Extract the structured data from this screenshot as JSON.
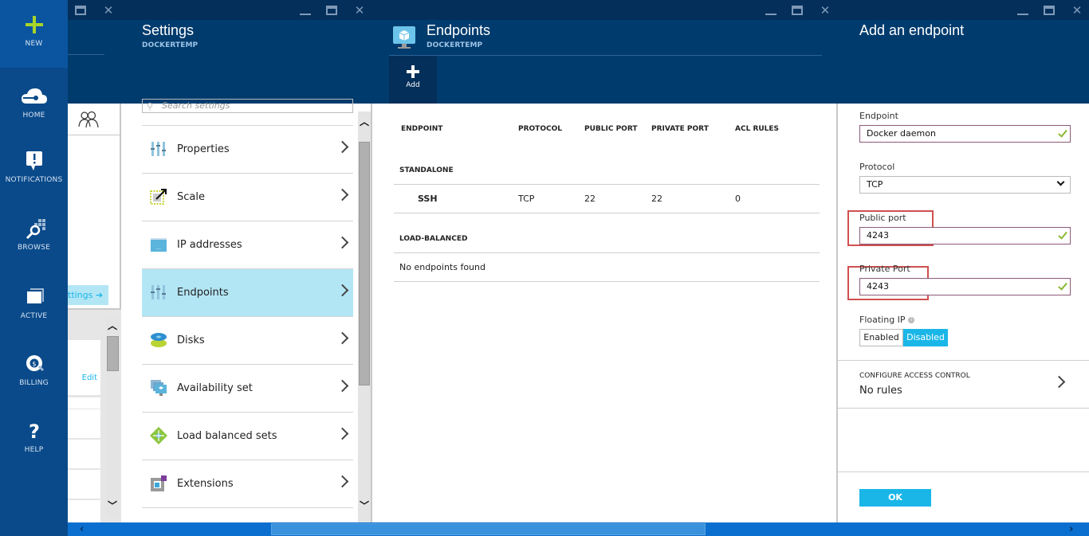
{
  "nav": {
    "items": [
      {
        "label": "NEW",
        "icon": "plus-icon"
      },
      {
        "label": "HOME",
        "icon": "cloud-icon"
      },
      {
        "label": "NOTIFICATIONS",
        "icon": "notification-icon"
      },
      {
        "label": "BROWSE",
        "icon": "browse-icon"
      },
      {
        "label": "ACTIVE",
        "icon": "active-windows-icon"
      },
      {
        "label": "BILLING",
        "icon": "billing-icon"
      },
      {
        "label": "HELP",
        "icon": "help-icon"
      }
    ]
  },
  "blade1": {
    "settings_link": "ttings",
    "edit_label": "Edit"
  },
  "settings": {
    "title": "Settings",
    "subtitle": "DOCKERTEMP",
    "search_placeholder": "Search settings",
    "items": [
      {
        "label": "Properties",
        "icon": "properties-icon"
      },
      {
        "label": "Scale",
        "icon": "scale-icon"
      },
      {
        "label": "IP addresses",
        "icon": "ip-addresses-icon"
      },
      {
        "label": "Endpoints",
        "icon": "endpoints-icon",
        "selected": true
      },
      {
        "label": "Disks",
        "icon": "disks-icon"
      },
      {
        "label": "Availability set",
        "icon": "availability-set-icon"
      },
      {
        "label": "Load balanced sets",
        "icon": "load-balanced-icon"
      },
      {
        "label": "Extensions",
        "icon": "extensions-icon"
      }
    ]
  },
  "endpoints": {
    "title": "Endpoints",
    "subtitle": "DOCKERTEMP",
    "add_label": "Add",
    "columns": [
      "ENDPOINT",
      "PROTOCOL",
      "PUBLIC PORT",
      "PRIVATE PORT",
      "ACL RULES"
    ],
    "standalone_label": "STANDALONE",
    "rows": [
      {
        "endpoint": "SSH",
        "protocol": "TCP",
        "public_port": "22",
        "private_port": "22",
        "acl_rules": "0"
      }
    ],
    "load_balanced_label": "LOAD-BALANCED",
    "empty_message": "No endpoints found"
  },
  "add_endpoint": {
    "title": "Add an endpoint",
    "endpoint_label": "Endpoint",
    "endpoint_value": "Docker daemon",
    "protocol_label": "Protocol",
    "protocol_value": "TCP",
    "public_port_label": "Public port",
    "public_port_value": "4243",
    "private_port_label": "Private Port",
    "private_port_value": "4243",
    "floating_ip_label": "Floating IP",
    "floating_ip_options": [
      "Enabled",
      "Disabled"
    ],
    "floating_ip_selected": "Disabled",
    "access_control_heading": "CONFIGURE ACCESS CONTROL",
    "access_control_value": "No rules",
    "ok_label": "OK"
  },
  "colors": {
    "accent": "#1ab6e8",
    "selected_row": "#b3e6f5",
    "header_bg": "#003b6d",
    "nav_bg": "#0a4a8a",
    "highlight_box": "#d05050"
  }
}
